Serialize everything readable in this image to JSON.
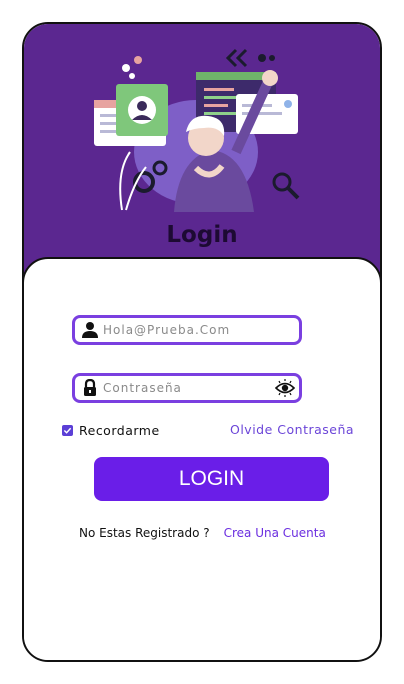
{
  "hero": {
    "title": "Login"
  },
  "form": {
    "email_placeholder": "Hola@Prueba.Com",
    "password_placeholder": "Contraseña",
    "remember_label": "Recordarme",
    "remember_checked": true,
    "forgot_label": "Olvide Contraseña",
    "login_label": "LOGIN"
  },
  "signup": {
    "prompt": "No Estas Registrado ?",
    "link": "Crea Una Cuenta"
  },
  "colors": {
    "hero_bg": "#5b2790",
    "accent": "#6a1ee8",
    "input_border": "#7a3fe0"
  }
}
